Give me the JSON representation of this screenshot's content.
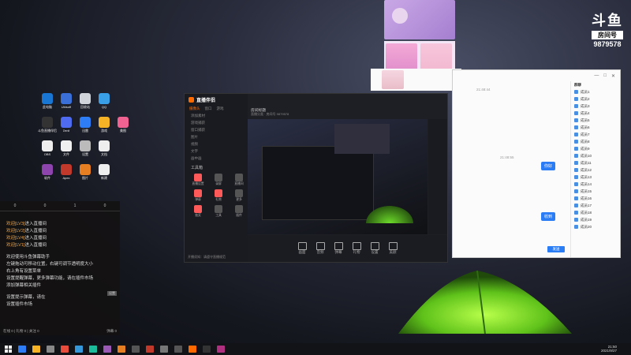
{
  "logo": {
    "brand": "斗鱼",
    "room_label": "房间号",
    "room_number": "9879578"
  },
  "desktop_icons": [
    {
      "label": "此电脑",
      "color": "#1976d2"
    },
    {
      "label": "Ubisoft",
      "color": "#3a6fd8"
    },
    {
      "label": "回收站",
      "color": "#d0d4da"
    },
    {
      "label": "QQ",
      "color": "#39a0e8"
    },
    {
      "label": "",
      "color": "#000"
    },
    {
      "label": "斗鱼直播伴侣",
      "color": "#333"
    },
    {
      "label": "Zenit",
      "color": "#4f6bef"
    },
    {
      "label": "迅雷",
      "color": "#2e7cf6"
    },
    {
      "label": "游戏",
      "color": "#f5b325"
    },
    {
      "label": "美图",
      "color": "#f06292"
    },
    {
      "label": "OBS",
      "color": "#eee"
    },
    {
      "label": "文件",
      "color": "#f0f0f0"
    },
    {
      "label": "设置",
      "color": "#bbb"
    },
    {
      "label": "文档",
      "color": "#eee"
    },
    {
      "label": "",
      "color": "#000"
    },
    {
      "label": "软件",
      "color": "#8e44ad"
    },
    {
      "label": "Apex",
      "color": "#c0392b"
    },
    {
      "label": "图片",
      "color": "#e67e22"
    },
    {
      "label": "新建",
      "color": "#eee"
    },
    {
      "label": "",
      "color": "#000"
    }
  ],
  "chat": {
    "stats": [
      "0",
      "0",
      "1",
      "0"
    ],
    "messages": [
      {
        "user": "欢迎[LV3]",
        "text": "进入直播间"
      },
      {
        "user": "欢迎[LV2]",
        "text": "进入直播间"
      },
      {
        "user": "欢迎[LV4]",
        "text": "进入直播间"
      },
      {
        "user": "欢迎[LV1]",
        "text": "进入直播间"
      }
    ],
    "system_lines": [
      "欢迎使用斗鱼弹幕助手",
      "左键拖动可移动位置，右键可调节透明度大小",
      "右上角有设置菜单",
      "设置提醒弹幕，更多弹幕功能，请在插件市场",
      "添加弹幕相关插件"
    ],
    "badge": "设置",
    "tail_lines": [
      "设置提示弹幕，请在",
      "设置插件市场"
    ],
    "footer_left": "在线 0 | 礼物 0 | 关注 0",
    "footer_right": "弹幕 0"
  },
  "app": {
    "brand": "直播伴侣",
    "tabs": [
      "摄像头",
      "窗口",
      "游戏"
    ],
    "menu": [
      "添加素材",
      "游戏捕获",
      "窗口捕获",
      "图片",
      "视频",
      "文字",
      "画中画"
    ],
    "tools_title": "工具箱",
    "tools": [
      {
        "label": "直播设置",
        "color": "#ff5a5a"
      },
      {
        "label": "录屏",
        "color": "#555"
      },
      {
        "label": "直播间",
        "color": "#555"
      },
      {
        "label": "弹幕",
        "color": "#ff5a5a"
      },
      {
        "label": "礼物",
        "color": "#ff5a5a"
      },
      {
        "label": "更多",
        "color": "#555"
      },
      {
        "label": "抽奖",
        "color": "#ff5a5a"
      },
      {
        "label": "工具",
        "color": "#555"
      },
      {
        "label": "插件",
        "color": "#555"
      }
    ],
    "room_title": "房间标题",
    "room_sub": "直播分类 · 房间号 9879578",
    "bottom_buttons": [
      "画面",
      "音频",
      "弹幕",
      "礼物",
      "设置",
      "美颜"
    ],
    "footnote": "开播须知：请遵守直播规范"
  },
  "right_window": {
    "topbar": [
      "—",
      "□",
      "✕"
    ],
    "time1": "21:48:44",
    "time2": "21:48:55",
    "bubble1": "你好",
    "bubble2": "收到",
    "send": "发送",
    "title": "群聊",
    "members": [
      "成员1",
      "成员2",
      "成员3",
      "成员4",
      "成员5",
      "成员6",
      "成员7",
      "成员8",
      "成员9",
      "成员10",
      "成员11",
      "成员12",
      "成员13",
      "成员14",
      "成员15",
      "成员16",
      "成员17",
      "成员18",
      "成员19",
      "成员20"
    ]
  },
  "taskbar": {
    "icons": [
      "#2e7cf6",
      "#f5b325",
      "#888",
      "#e74c3c",
      "#3498db",
      "#1abc9c",
      "#9b59b6",
      "#e67e22",
      "#555",
      "#c0392b",
      "#777",
      "#555",
      "#ff6a00",
      "#333",
      "#b03080"
    ],
    "time": "21:50",
    "date": "2021/9/27"
  }
}
